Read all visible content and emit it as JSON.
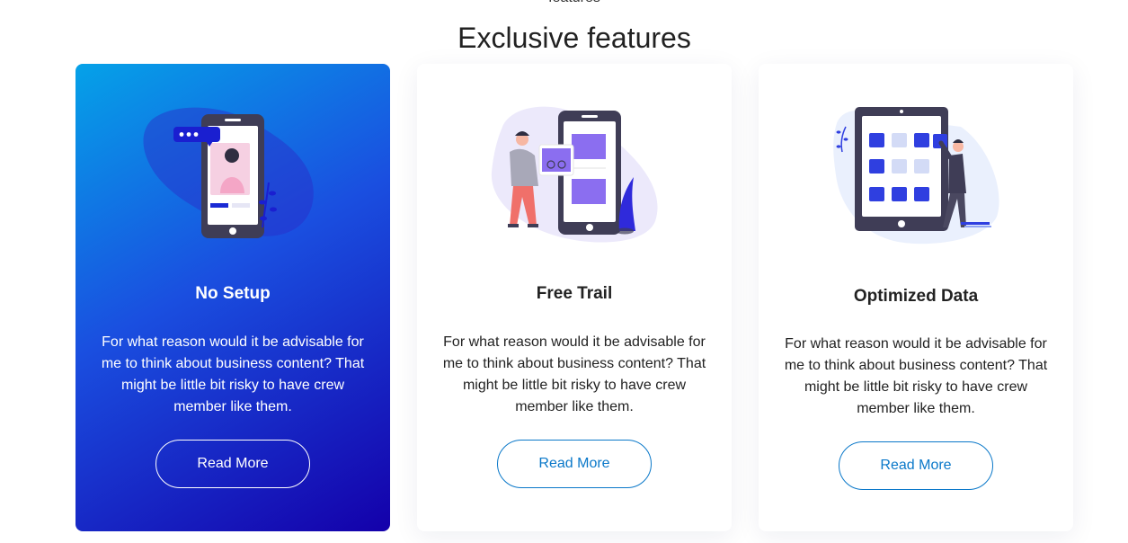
{
  "section": {
    "eyebrow": "features",
    "title": "Exclusive features"
  },
  "cards": [
    {
      "title": "No Setup",
      "text": "For what reason would it be advisable for me to think about business content? That might be little bit risky to have crew member like them.",
      "button_label": "Read More",
      "active": true,
      "illustration": "phone-chat-illustration"
    },
    {
      "title": "Free Trail",
      "text": "For what reason would it be advisable for me to think about business content? That might be little bit risky to have crew member like them.",
      "button_label": "Read More",
      "active": false,
      "illustration": "phone-media-illustration"
    },
    {
      "title": "Optimized Data",
      "text": "For what reason would it be advisable for me to think about business content? That might be little bit risky to have crew member like them.",
      "button_label": "Read More",
      "active": false,
      "illustration": "tablet-grid-illustration"
    }
  ],
  "colors": {
    "accent": "#0a78c9",
    "active_gradient_start": "#05a2e8",
    "active_gradient_end": "#1400aa",
    "illustration_dark": "#3f3d56",
    "illustration_primary": "#2f3fe0",
    "illustration_purple": "#8b6ef0"
  }
}
